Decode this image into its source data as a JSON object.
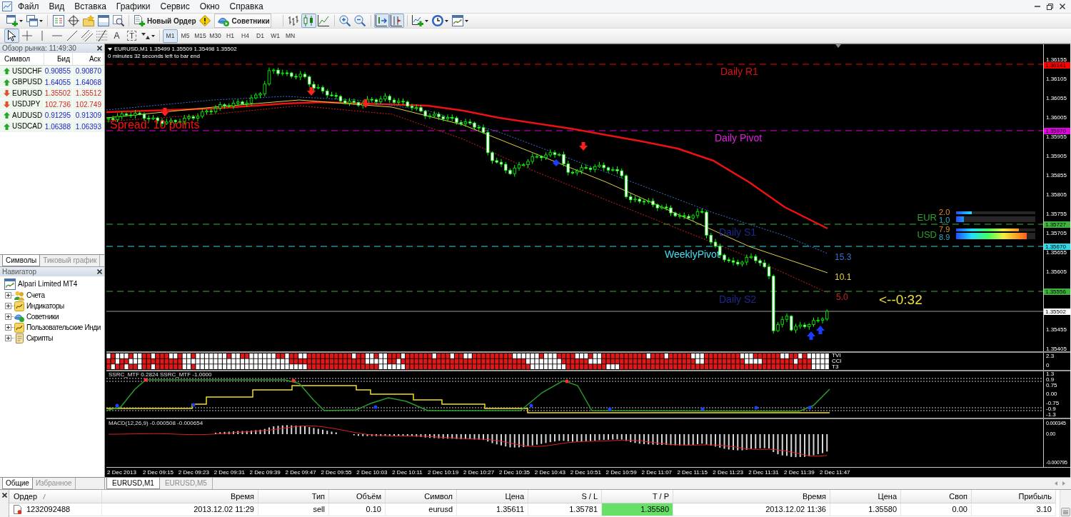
{
  "menu": [
    "Файл",
    "Вид",
    "Вставка",
    "Графики",
    "Сервис",
    "Окно",
    "Справка"
  ],
  "toolbar": {
    "new_order": "Новый Ордер",
    "experts": "Советники",
    "chart_types": [
      {
        "kind": "bars",
        "selected": false
      },
      {
        "kind": "candles",
        "selected": true
      },
      {
        "kind": "line",
        "selected": false
      }
    ],
    "toggles": [
      {
        "kind": "auto_scroll",
        "on": true
      },
      {
        "kind": "chart_shift",
        "on": true
      }
    ]
  },
  "drawing_toolbar": {
    "tools": [
      {
        "kind": "cursor",
        "selected": true
      },
      {
        "kind": "crosshair",
        "selected": false
      },
      {
        "kind": "vertical_line",
        "selected": false
      },
      {
        "kind": "horizontal_line",
        "selected": false
      },
      {
        "kind": "trendline",
        "selected": false
      },
      {
        "kind": "channel",
        "selected": false
      },
      {
        "kind": "fibonacci",
        "selected": false
      },
      {
        "kind": "text",
        "glyph": "A",
        "selected": false
      },
      {
        "kind": "label",
        "glyph": "T",
        "selected": false
      },
      {
        "kind": "arrows",
        "selected": false
      }
    ],
    "periods": [
      {
        "label": "M1",
        "selected": true
      },
      {
        "label": "M5",
        "selected": false
      },
      {
        "label": "M15",
        "selected": false
      },
      {
        "label": "M30",
        "selected": false
      },
      {
        "label": "H1",
        "selected": false
      },
      {
        "label": "H4",
        "selected": false
      },
      {
        "label": "D1",
        "selected": false
      },
      {
        "label": "W1",
        "selected": false
      },
      {
        "label": "MN",
        "selected": false
      }
    ]
  },
  "market_watch": {
    "title": "Обзор рынка: 11:49:30",
    "columns": [
      "Символ",
      "Бид",
      "Аск"
    ],
    "rows": [
      {
        "symbol": "USDCHF",
        "bid": "0.90855",
        "ask": "0.90870",
        "rising": true
      },
      {
        "symbol": "GBPUSD",
        "bid": "1.64055",
        "ask": "1.64068",
        "rising": true
      },
      {
        "symbol": "EURUSD",
        "bid": "1.35502",
        "ask": "1.35512",
        "rising": false
      },
      {
        "symbol": "USDJPY",
        "bid": "102.736",
        "ask": "102.749",
        "rising": false
      },
      {
        "symbol": "AUDUSD",
        "bid": "0.91295",
        "ask": "0.91309",
        "rising": true
      },
      {
        "symbol": "USDCAD",
        "bid": "1.06388",
        "ask": "1.06393",
        "rising": true
      }
    ],
    "tabs": [
      {
        "label": "Символы",
        "selected": true
      },
      {
        "label": "Тиковый график",
        "selected": false
      }
    ]
  },
  "navigator": {
    "title": "Навигатор",
    "root": {
      "label": "Alpari Limited MT4",
      "children": [
        {
          "label": "Счета",
          "kind": "accounts",
          "expanded": false
        },
        {
          "label": "Индикаторы",
          "kind": "indicators",
          "expanded": false
        },
        {
          "label": "Советники",
          "kind": "experts",
          "expanded": false
        },
        {
          "label": "Пользовательские Инди",
          "kind": "custom_indicators",
          "expanded": false
        },
        {
          "label": "Скрипты",
          "kind": "scripts",
          "expanded": false
        }
      ]
    },
    "tabs": [
      {
        "label": "Общие",
        "selected": true
      },
      {
        "label": "Избранное",
        "selected": false
      }
    ]
  },
  "chart": {
    "symbol_line": "EURUSD,M1 1.35499 1.35509 1.35498 1.35502",
    "bar_timer_note": "0 minutes 32 seconds left to bar end",
    "spread": "Spread: 10 points",
    "level_labels": [
      {
        "text": "Daily R1",
        "color": "#e01010"
      },
      {
        "text": "Daily Pivot",
        "color": "#e020e0"
      },
      {
        "text": "Daily S1",
        "color": "#1c2a8c"
      },
      {
        "text": "WeeklyPivot",
        "color": "#40e0f0"
      },
      {
        "text": "Daily S2",
        "color": "#1c2a8c"
      }
    ],
    "level_lines": [
      {
        "tag": "1.36141",
        "color": "#ff0000"
      },
      {
        "tag": "1.35970",
        "color": "#e000e0"
      },
      {
        "tag": "1.35727",
        "color": "#3cb43c"
      },
      {
        "tag": "1.35670",
        "color": "#30d8e8"
      },
      {
        "tag": "1.35556",
        "color": "#3cb43c"
      }
    ],
    "bid_tag": "1.35502",
    "price_ticks": [
      "1.36155",
      "1.36105",
      "1.36055",
      "1.36005",
      "1.35955",
      "1.35905",
      "1.35855",
      "1.35805",
      "1.35755",
      "1.35705",
      "1.35655",
      "1.35605",
      "1.35455",
      "1.35405"
    ],
    "ma_labels": [
      {
        "text": "15.3",
        "color": "#3a6fd0"
      },
      {
        "text": "10.1",
        "color": "#e0d040"
      },
      {
        "text": "5.0",
        "color": "#d02020"
      }
    ],
    "timer": "<--0:32",
    "strength": [
      {
        "currency": "EUR",
        "values": [
          {
            "text": "2.0",
            "level": 0.2
          },
          {
            "text": "1.0",
            "level": 0.1
          }
        ]
      },
      {
        "currency": "USD",
        "values": [
          {
            "text": "7.9",
            "level": 0.79
          },
          {
            "text": "8.9",
            "level": 0.89
          }
        ]
      }
    ],
    "signal_panel": {
      "labels": [
        "TVI",
        "CCI",
        "T3"
      ],
      "axis": [
        "2.3",
        "0"
      ]
    },
    "ssrc": {
      "title": "SSRC_MTF 0.2824 SSRC_MTF -1.0000",
      "axis": [
        "1.3",
        "0.9",
        "0.75",
        "0.00",
        "-0.75",
        "-0.9",
        "-1.3"
      ]
    },
    "macd": {
      "title": "MACD(12,26,9) -0.000508 -0.000654",
      "axis": [
        "0.000345",
        "0.00",
        "-0.000795"
      ]
    },
    "time_ticks": [
      "2 Dec 2013",
      "2 Dec 09:15",
      "2 Dec 09:23",
      "2 Dec 09:31",
      "2 Dec 09:39",
      "2 Dec 09:47",
      "2 Dec 09:55",
      "2 Dec 10:03",
      "2 Dec 10:11",
      "2 Dec 10:19",
      "2 Dec 10:27",
      "2 Dec 10:35",
      "2 Dec 10:43",
      "2 Dec 10:51",
      "2 Dec 10:59",
      "2 Dec 11:07",
      "2 Dec 11:15",
      "2 Dec 11:23",
      "2 Dec 11:31",
      "2 Dec 11:39",
      "2 Dec 11:47"
    ]
  },
  "chart_tabs": [
    {
      "label": "EURUSD,M1",
      "selected": true
    },
    {
      "label": "EURUSD,M5",
      "selected": false
    }
  ],
  "terminal": {
    "columns": [
      {
        "label": "Ордер",
        "sorted": true
      },
      {
        "label": "Время",
        "sorted": false
      },
      {
        "label": "Тип",
        "sorted": false
      },
      {
        "label": "Объём",
        "sorted": false
      },
      {
        "label": "Символ",
        "sorted": false
      },
      {
        "label": "Цена",
        "sorted": false
      },
      {
        "label": "S / L",
        "sorted": false
      },
      {
        "label": "T / P",
        "sorted": false
      },
      {
        "label": "Время",
        "sorted": false
      },
      {
        "label": "Цена",
        "sorted": false
      },
      {
        "label": "Своп",
        "sorted": false
      },
      {
        "label": "Прибыль",
        "sorted": false
      }
    ],
    "rows": [
      {
        "order": "1232092488",
        "open_time": "2013.12.02 11:29",
        "type": "sell",
        "volume": "0.10",
        "symbol": "eurusd",
        "open_price": "1.35611",
        "sl": "1.35781",
        "tp": "1.35580",
        "tp_hit": true,
        "close_time": "2013.12.02 11:36",
        "close_price": "1.35580",
        "swap": "0.00",
        "profit": "3.10"
      }
    ]
  }
}
